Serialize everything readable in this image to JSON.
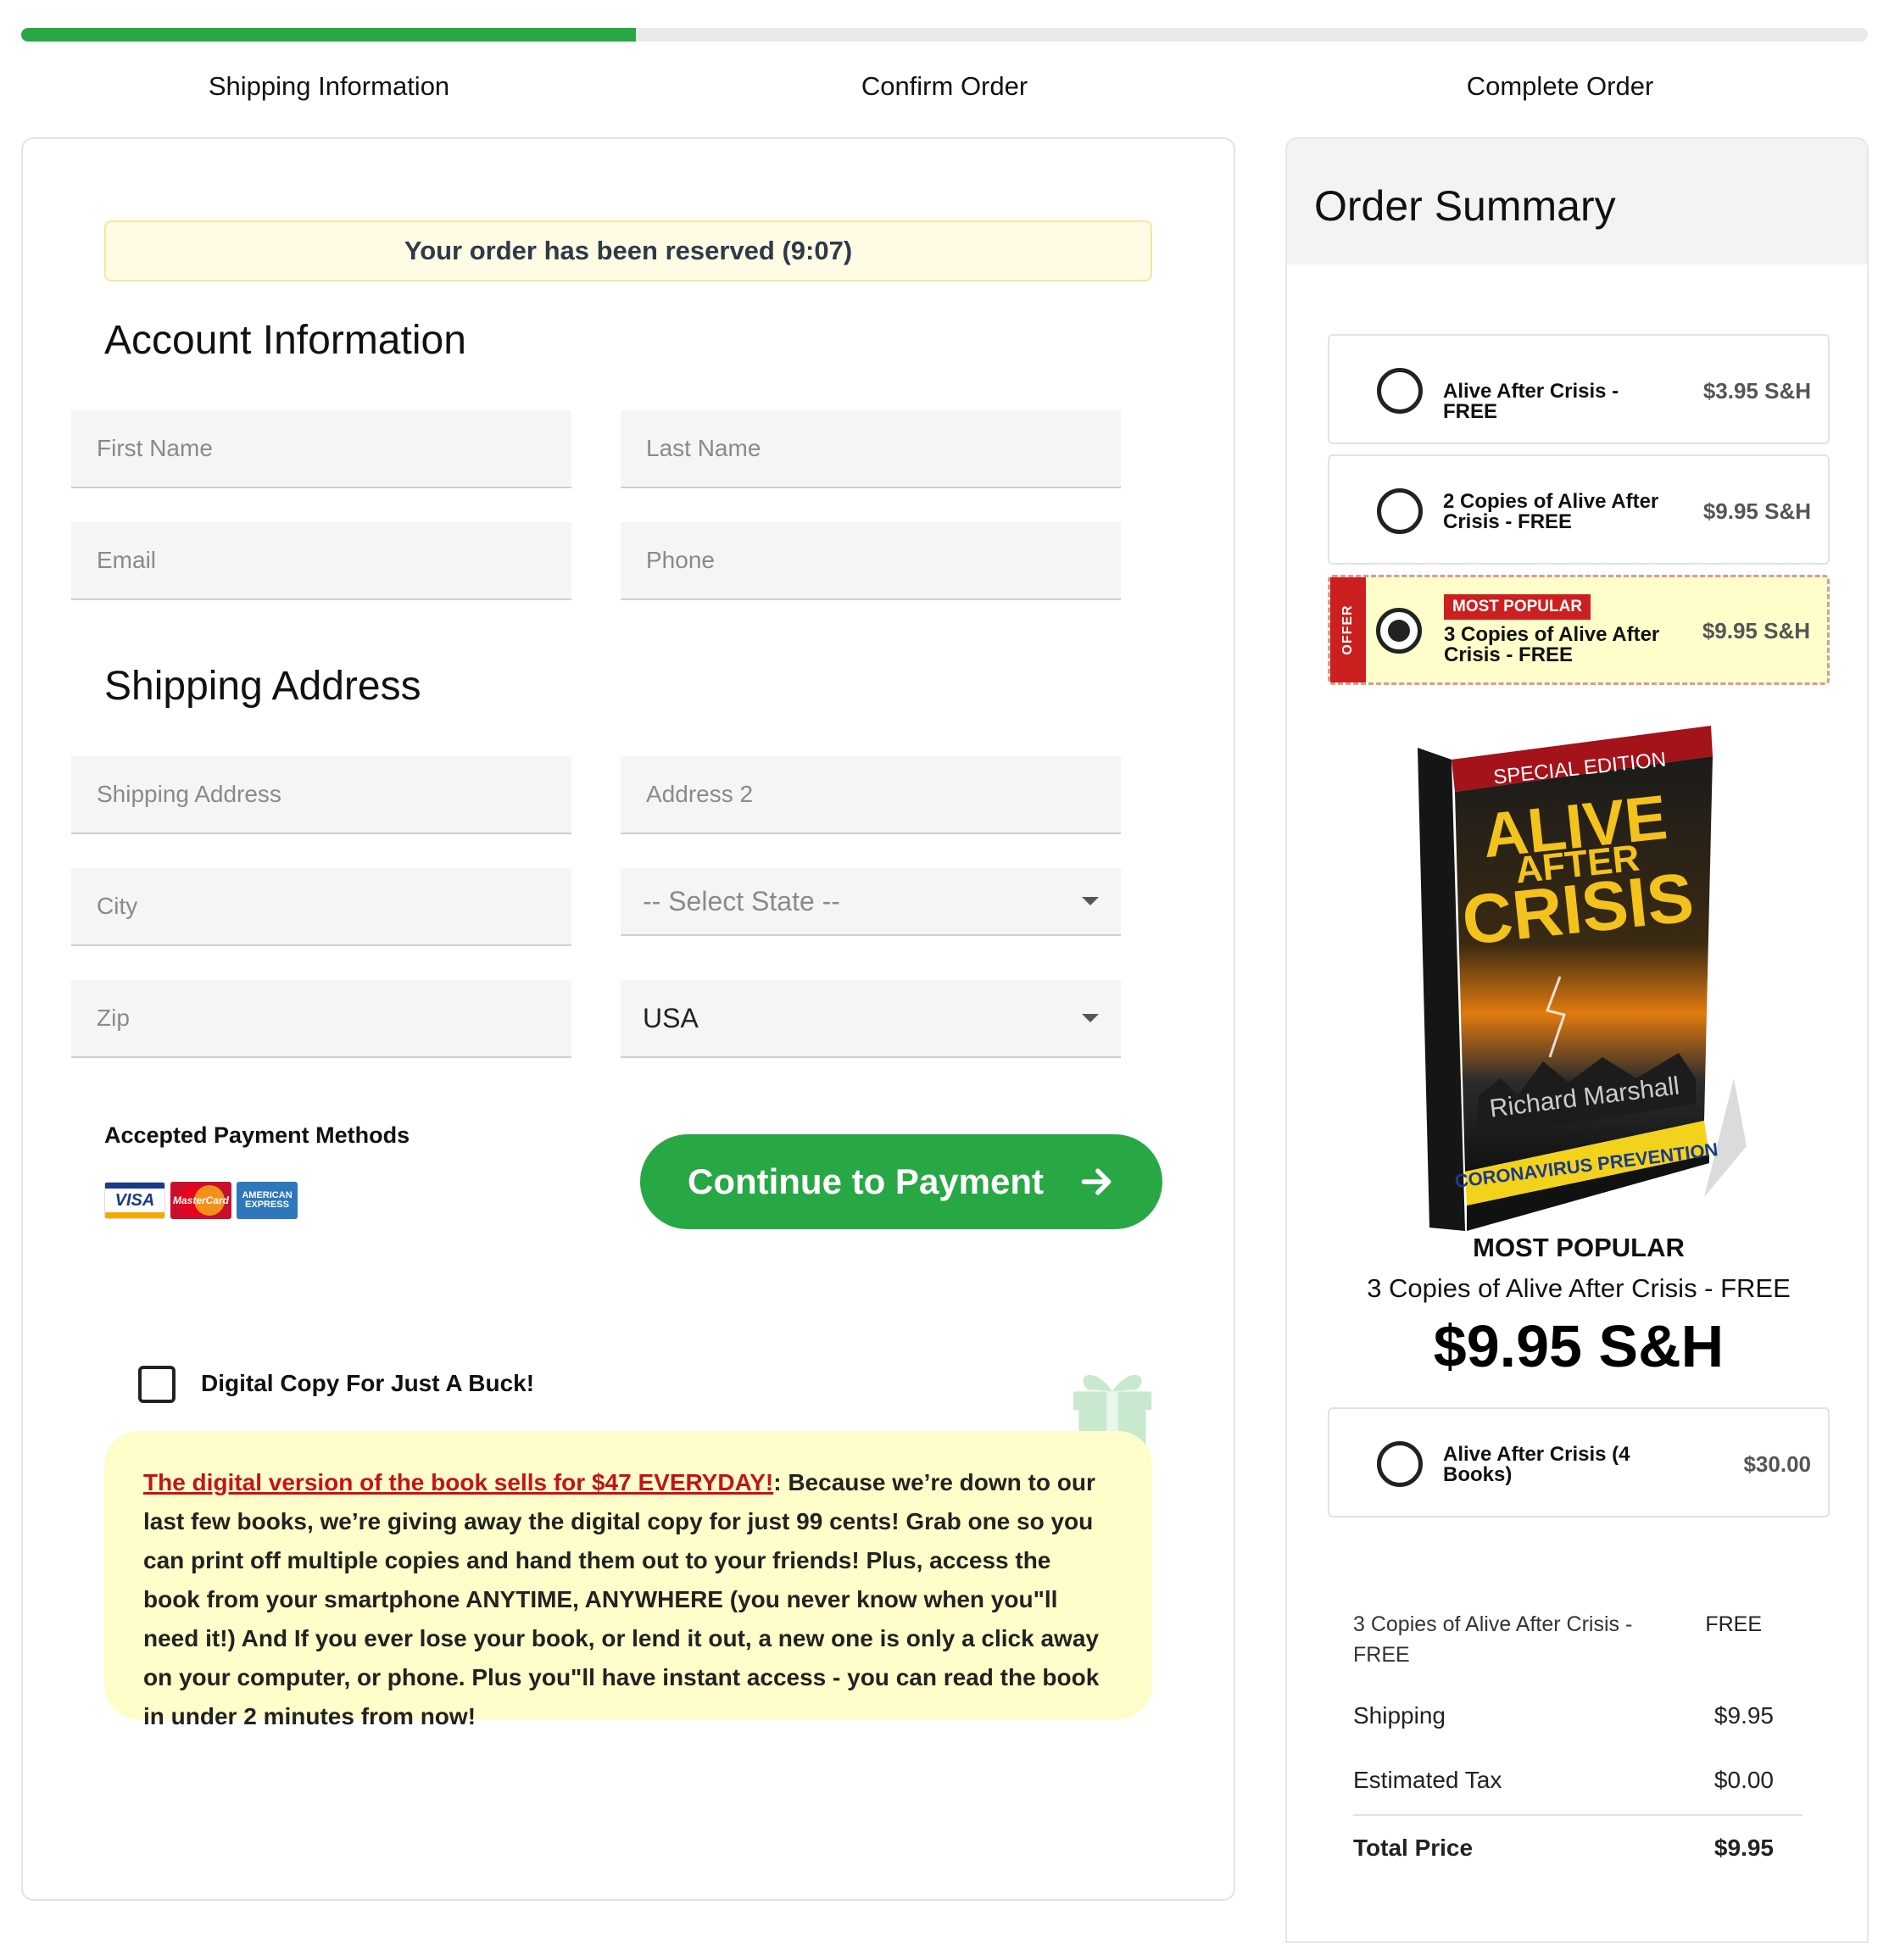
{
  "progress": {
    "percent": 33.3
  },
  "steps": [
    "Shipping Information",
    "Confirm Order",
    "Complete Order"
  ],
  "reserve_notice": "Your order has been reserved (9:07)",
  "account": {
    "title": "Account Information",
    "first_name_placeholder": "First Name",
    "last_name_placeholder": "Last Name",
    "email_placeholder": "Email",
    "phone_placeholder": "Phone"
  },
  "shipping": {
    "title": "Shipping Address",
    "address_placeholder": "Shipping Address",
    "address2_placeholder": "Address 2",
    "city_placeholder": "City",
    "state_selected": "-- Select State --",
    "zip_placeholder": "Zip",
    "country_selected": "USA"
  },
  "payment": {
    "label": "Accepted Payment Methods",
    "cards": [
      "VISA",
      "MasterCard",
      "AMERICAN EXPRESS"
    ],
    "continue_label": "Continue to Payment"
  },
  "upsell": {
    "checkbox_label": "Digital Copy For Just A Buck!",
    "highlight": "The digital version of the book sells for $47 EVERYDAY!",
    "body": ": Because we’re down to our last few books, we’re giving away the digital copy for just 99 cents! Grab one so you can print off multiple copies and hand them out to your friends! Plus, access the book from your smartphone ANYTIME, ANYWHERE (you never know when you\"ll need it!) And If you ever lose your book, or lend it out, a new one is only a click away on your computer, or phone. Plus you\"ll have instant access - you can read the book in under 2 minutes from now!"
  },
  "summary": {
    "title": "Order Summary",
    "options": [
      {
        "name": "Alive After Crisis - FREE",
        "price": "$3.95 S&H",
        "selected": false
      },
      {
        "name": "2 Copies of Alive After Crisis - FREE",
        "price": "$9.95 S&H",
        "selected": false
      },
      {
        "name": "3 Copies of Alive After Crisis - FREE",
        "price": "$9.95 S&H",
        "selected": true,
        "badge": "MOST POPULAR",
        "tag": "OFFER"
      },
      {
        "name": "Alive After Crisis (4 Books)",
        "price": "$30.00",
        "selected": false
      }
    ],
    "book": {
      "edition": "SPECIAL EDITION",
      "title1": "ALIVE",
      "title2": "AFTER",
      "title3": "CRISIS",
      "author": "Richard Marshall",
      "footer": "CORONAVIRUS PREVENTION"
    },
    "featured_label": "MOST POPULAR",
    "featured_name": "3 Copies of Alive After Crisis - FREE",
    "featured_price": "$9.95 S&H",
    "lines": [
      {
        "label": "3 Copies of Alive After Crisis - FREE",
        "value": "FREE"
      },
      {
        "label": "Shipping",
        "value": "$9.95"
      },
      {
        "label": "Estimated Tax",
        "value": "$0.00"
      }
    ],
    "total": {
      "label": "Total Price",
      "value": "$9.95"
    }
  },
  "colors": {
    "accent_green": "#28a745",
    "offer_red": "#cc1f1f",
    "highlight_yellow": "#fffdc9"
  }
}
